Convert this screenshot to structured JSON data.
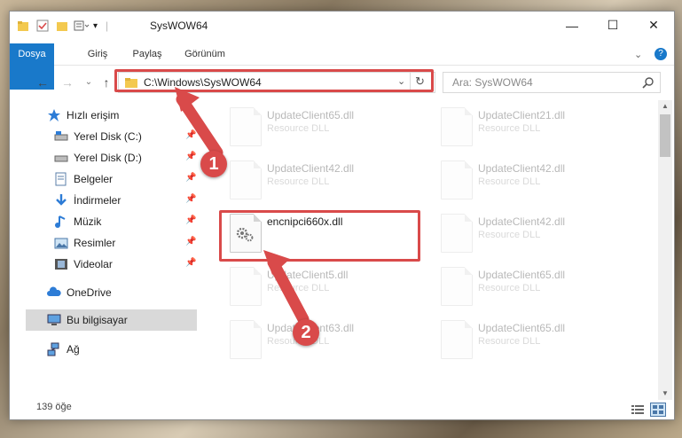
{
  "window": {
    "title": "SysWOW64"
  },
  "ribbon": {
    "tabs": [
      "Dosya",
      "Giriş",
      "Paylaş",
      "Görünüm"
    ]
  },
  "address": {
    "path": "C:\\Windows\\SysWOW64",
    "search_placeholder": "Ara: SysWOW64"
  },
  "sidebar": {
    "items": [
      {
        "label": "Hızlı erişim",
        "icon": "star-icon"
      },
      {
        "label": "Yerel Disk (C:)",
        "icon": "drive-icon"
      },
      {
        "label": "Yerel Disk (D:)",
        "icon": "drive-icon"
      },
      {
        "label": "Belgeler",
        "icon": "documents-icon"
      },
      {
        "label": "İndirmeler",
        "icon": "download-icon"
      },
      {
        "label": "Müzik",
        "icon": "music-icon"
      },
      {
        "label": "Resimler",
        "icon": "pictures-icon"
      },
      {
        "label": "Videolar",
        "icon": "videos-icon"
      },
      {
        "label": "OneDrive",
        "icon": "cloud-icon"
      },
      {
        "label": "Bu bilgisayar",
        "icon": "computer-icon"
      },
      {
        "label": "Ağ",
        "icon": "network-icon"
      }
    ]
  },
  "files": {
    "type": "Resource DLL",
    "left": [
      "UpdateClient65.dll",
      "UpdateClient42.dll",
      "encnipci660x.dll",
      "UpdateClient5.dll",
      "UpdateClient63.dll"
    ],
    "right": [
      "UpdateClient21.dll",
      "UpdateClient42.dll",
      "UpdateClient42.dll",
      "UpdateClient65.dll",
      "UpdateClient65.dll"
    ]
  },
  "status": {
    "count": "139 öğe"
  },
  "badges": {
    "one": "1",
    "two": "2"
  },
  "colors": {
    "accent": "#1979ca",
    "highlight": "#d94a4a"
  }
}
